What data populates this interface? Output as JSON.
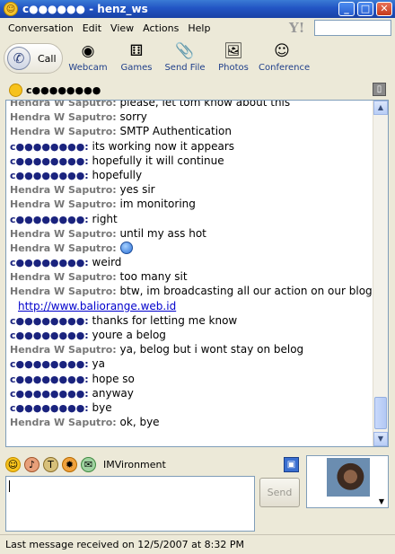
{
  "window": {
    "title": "c●●●●●● - henz_ws",
    "minimize": "_",
    "maximize": "□",
    "close": "✕"
  },
  "menu": [
    "Conversation",
    "Edit",
    "View",
    "Actions",
    "Help"
  ],
  "menu_yahoo_logo": "Y!",
  "toolbar": {
    "call": "Call",
    "tools": [
      {
        "label": "Webcam",
        "icon": "webcam-icon"
      },
      {
        "label": "Games",
        "icon": "games-icon"
      },
      {
        "label": "Send File",
        "icon": "send-file-icon"
      },
      {
        "label": "Photos",
        "icon": "photos-icon"
      },
      {
        "label": "Conference",
        "icon": "conference-icon"
      }
    ]
  },
  "contact": {
    "name": "c●●●●●●●●"
  },
  "messages": [
    {
      "sender": "Hendra W Saputro:",
      "text": "please, let tom know about this",
      "me": false
    },
    {
      "sender": "Hendra W Saputro:",
      "text": "sorry",
      "me": false
    },
    {
      "sender": "Hendra W Saputro:",
      "text": "SMTP Authentication",
      "me": false
    },
    {
      "sender": "c●●●●●●●●:",
      "text": "its working now it appears",
      "me": true
    },
    {
      "sender": "c●●●●●●●●:",
      "text": "hopefully it will continue",
      "me": true
    },
    {
      "sender": "c●●●●●●●●:",
      "text": "hopefully",
      "me": true
    },
    {
      "sender": "Hendra W Saputro:",
      "text": "yes sir",
      "me": false
    },
    {
      "sender": "Hendra W Saputro:",
      "text": "im monitoring",
      "me": false
    },
    {
      "sender": "c●●●●●●●●:",
      "text": "right",
      "me": true
    },
    {
      "sender": "Hendra W Saputro:",
      "text": "until my ass hot",
      "me": false
    },
    {
      "sender": "Hendra W Saputro:",
      "text": "",
      "me": false,
      "emoticon": true
    },
    {
      "sender": "c●●●●●●●●:",
      "text": "weird",
      "me": true
    },
    {
      "sender": "Hendra W Saputro:",
      "text": "too many sit",
      "me": false
    },
    {
      "sender": "Hendra W Saputro:",
      "text": "btw, im broadcasting all our action on our blog at",
      "me": false
    },
    {
      "sender": "",
      "text": "http://www.baliorange.web.id",
      "me": false,
      "link": true
    },
    {
      "sender": "c●●●●●●●●:",
      "text": "thanks for letting me know",
      "me": true
    },
    {
      "sender": "c●●●●●●●●:",
      "text": "youre a belog",
      "me": true
    },
    {
      "sender": "Hendra W Saputro:",
      "text": "ya, belog but i wont stay on belog",
      "me": false
    },
    {
      "sender": "c●●●●●●●●:",
      "text": "ya",
      "me": true
    },
    {
      "sender": "c●●●●●●●●:",
      "text": "hope so",
      "me": true
    },
    {
      "sender": "c●●●●●●●●:",
      "text": "anyway",
      "me": true
    },
    {
      "sender": "c●●●●●●●●:",
      "text": "bye",
      "me": true
    },
    {
      "sender": "Hendra W Saputro:",
      "text": "ok, bye",
      "me": false
    }
  ],
  "format_bar": {
    "imvironment": "IMVironment"
  },
  "send_label": "Send",
  "status": "Last message received on 12/5/2007 at 8:32 PM"
}
